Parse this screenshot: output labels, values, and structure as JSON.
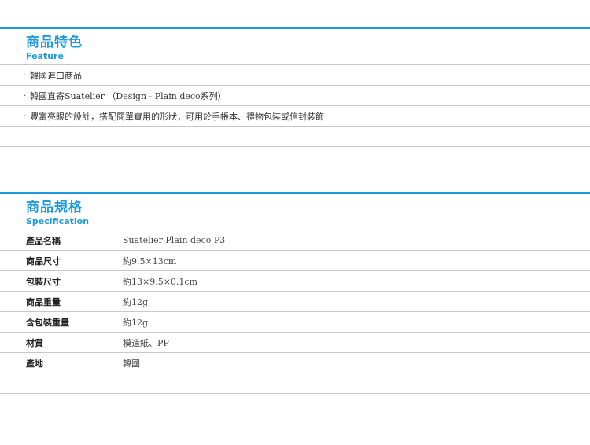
{
  "feature": {
    "title_zh": "商品特色",
    "title_en": "Feature",
    "bullet": "·",
    "items": [
      "韓國進口商品",
      "韓國直寄Suatelier （Design - Plain deco系列）",
      "豐富亮眼的設計，搭配簡單實用的形狀，可用於手帳本、禮物包裝或信封裝飾"
    ]
  },
  "spec": {
    "title_zh": "商品規格",
    "title_en": "Specification",
    "rows": [
      {
        "label": "產品名稱",
        "value": "Suatelier Plain deco P3"
      },
      {
        "label": "商品尺寸",
        "value": "約9.5×13cm"
      },
      {
        "label": "包裝尺寸",
        "value": "約13×9.5×0.1cm"
      },
      {
        "label": "商品重量",
        "value": "約12g"
      },
      {
        "label": "含包裝重量",
        "value": "約12g"
      },
      {
        "label": "材質",
        "value": "模造紙、PP"
      },
      {
        "label": "產地",
        "value": "韓國"
      }
    ]
  },
  "colors": {
    "accent": "#1a9bdc",
    "divider": "#c8c8c8"
  }
}
